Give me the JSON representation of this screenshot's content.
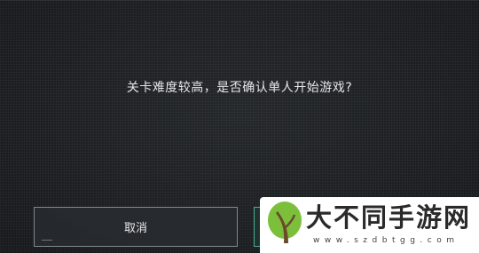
{
  "dialog": {
    "message": "关卡难度较高，是否确认单人开始游戏?",
    "cancel_label": "取消",
    "confirm_label": ""
  },
  "watermark": {
    "title": "大不同手游网",
    "url": "www.szdbtgg.com"
  },
  "colors": {
    "background": "#1f2225",
    "text": "#e4e6e8",
    "confirm_border": "#5ac8aa",
    "logo_green": "#7cbf3a",
    "logo_brown": "#6b4a2b"
  }
}
